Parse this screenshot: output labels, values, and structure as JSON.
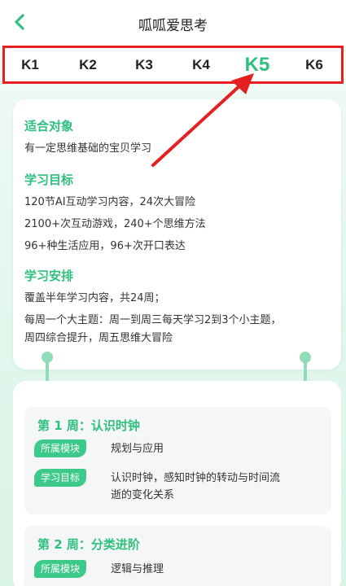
{
  "header": {
    "title": "呱呱爱思考",
    "back_icon": "chevron-left-icon"
  },
  "tabs": [
    {
      "label": "K1",
      "active": false
    },
    {
      "label": "K2",
      "active": false
    },
    {
      "label": "K3",
      "active": false
    },
    {
      "label": "K4",
      "active": false
    },
    {
      "label": "K5",
      "active": true
    },
    {
      "label": "K6",
      "active": false
    }
  ],
  "colors": {
    "accent": "#2fbf7f",
    "highlight_border": "#e62020",
    "arrow": "#e62020"
  },
  "overview": {
    "audience_title": "适合对象",
    "audience_text": "有一定思维基础的宝贝学习",
    "goals_title": "学习目标",
    "goals": [
      "120节AI互动学习内容，24次大冒险",
      "2100+次互动游戏，240+个思维方法",
      "96+种生活应用，96+次开口表达"
    ],
    "plan_title": "学习安排",
    "plan": [
      "覆盖半年学习内容，共24周；",
      "每周一个大主题：周一到周三每天学习2到3个小主题，",
      "周四综合提升，周五思维大冒险"
    ]
  },
  "weeks": [
    {
      "title": "第 1 周：认识时钟",
      "module_tag": "所属模块",
      "module": "规划与应用",
      "goal_tag": "学习目标",
      "goal_line1": "认识时钟，感知时钟的转动与时间流",
      "goal_line2": "逝的变化关系"
    },
    {
      "title": "第 2 周：分类进阶",
      "module_tag": "所属模块",
      "module": "逻辑与推理"
    }
  ]
}
